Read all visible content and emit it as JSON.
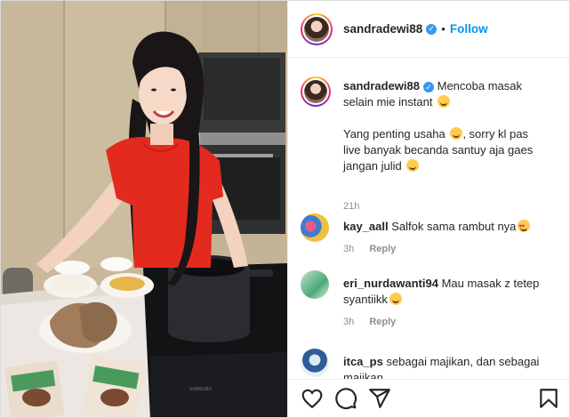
{
  "post": {
    "author": "sandradewi88",
    "follow_label": "Follow",
    "dot": "•",
    "caption_line1": "Mencoba masak",
    "caption_line2": "selain mie instant",
    "caption_p2_line1": "Yang penting usaha",
    "caption_p2_line2": ", sorry kl pas",
    "caption_p2_line3": "live banyak becanda santuy aja gaes",
    "caption_p2_line4": "jangan julid",
    "time": "21h"
  },
  "comments": [
    {
      "user": "kay_aall",
      "text": "Salfok sama rambut nya",
      "time": "3h",
      "reply": "Reply"
    },
    {
      "user": "eri_nurdawanti94",
      "text_line1": "Mau masak z tetep",
      "text_line2": "syantiikk",
      "time": "3h",
      "reply": "Reply"
    },
    {
      "user": "itca_ps",
      "text_line1": "sebagai majikan, dan sebagai",
      "text_line2": "majikan"
    }
  ],
  "icons": [
    "heart-icon",
    "comment-icon",
    "share-icon",
    "bookmark-icon",
    "verified-icon"
  ],
  "colors": {
    "follow": "#0095f6",
    "verified": "#3897f0",
    "shirt": "#e32a1f",
    "meta": "#8e8e8e"
  }
}
